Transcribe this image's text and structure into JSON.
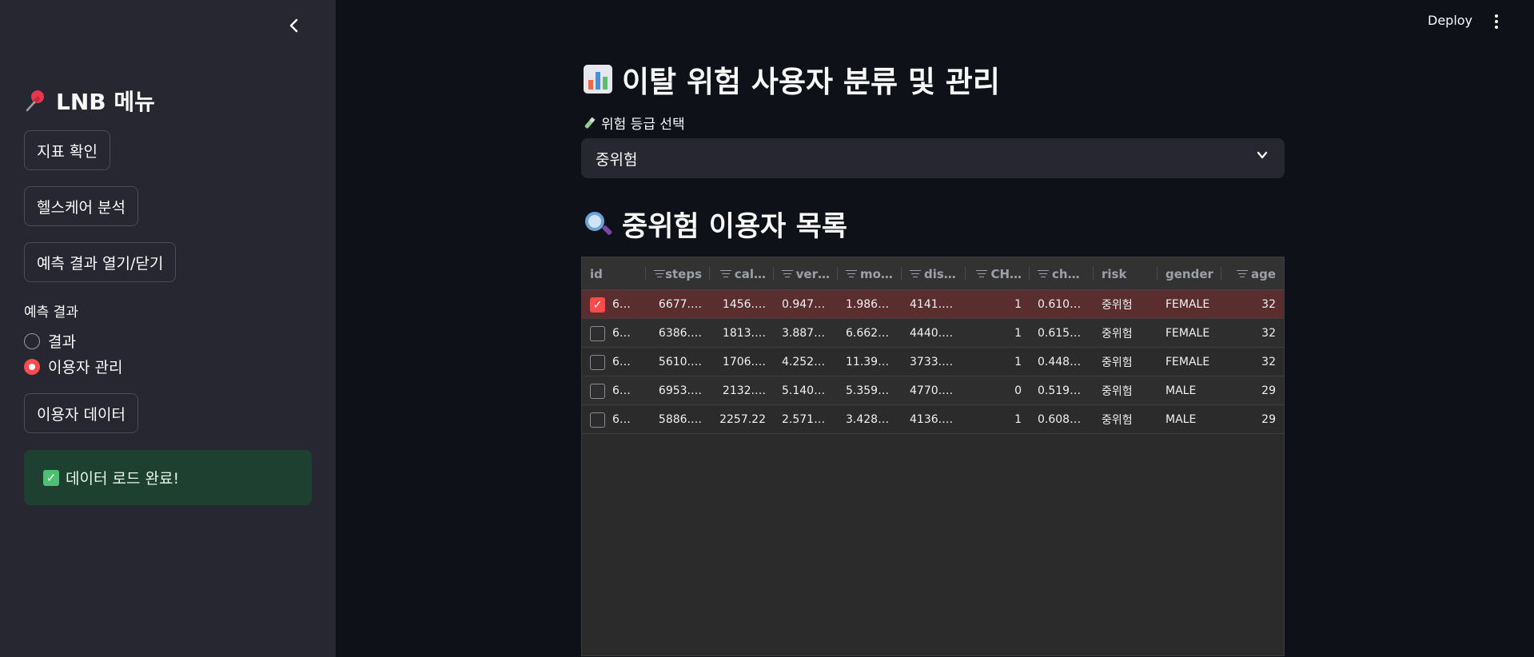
{
  "sidebar": {
    "title": "LNB 메뉴",
    "buttons": [
      "지표 확인",
      "헬스케어 분석",
      "예측 결과 열기/닫기"
    ],
    "radio_caption": "예측 결과",
    "radio_options": [
      {
        "label": "결과",
        "selected": false
      },
      {
        "label": "이용자 관리",
        "selected": true
      }
    ],
    "data_button": "이용자 데이터",
    "success_message": "데이터 로드 완료!"
  },
  "header": {
    "deploy_label": "Deploy"
  },
  "main": {
    "title": "이탈 위험 사용자 분류 및 관리",
    "select_label": "위험 등급 선택",
    "select_value": "중위험",
    "section_title": "중위험 이용자 목록"
  },
  "table": {
    "columns": [
      "id",
      "steps",
      "cal…",
      "ver…",
      "mo…",
      "dis…",
      "CH…",
      "ch…",
      "risk",
      "gender",
      "age"
    ],
    "rows": [
      {
        "selected": true,
        "cells": [
          "6…",
          "6677.…",
          "1456.…",
          "0.947…",
          "1.986…",
          "4141.…",
          "1",
          "0.610…",
          "중위험",
          "FEMALE",
          "32"
        ]
      },
      {
        "selected": false,
        "cells": [
          "6…",
          "6386.…",
          "1813.…",
          "3.887…",
          "6.662…",
          "4440.…",
          "1",
          "0.615…",
          "중위험",
          "FEMALE",
          "32"
        ]
      },
      {
        "selected": false,
        "cells": [
          "6…",
          "5610.…",
          "1706.…",
          "4.252…",
          "11.39…",
          "3733.…",
          "1",
          "0.448…",
          "중위험",
          "FEMALE",
          "32"
        ]
      },
      {
        "selected": false,
        "cells": [
          "6…",
          "6953.…",
          "2132.…",
          "5.140…",
          "5.359…",
          "4770.…",
          "0",
          "0.519…",
          "중위험",
          "MALE",
          "29"
        ]
      },
      {
        "selected": false,
        "cells": [
          "6…",
          "5886.…",
          "2257.22",
          "2.571…",
          "3.428…",
          "4136.…",
          "1",
          "0.608…",
          "중위험",
          "MALE",
          "29"
        ]
      }
    ]
  },
  "colors": {
    "accent": "#ff4b4b",
    "success_bg": "#1e4030",
    "sidebar_bg": "#262730",
    "main_bg": "#0e1117"
  },
  "icons": {
    "title_icon": "bar-chart-icon",
    "select_icon": "test-tube-icon",
    "section_icon": "magnifier-icon",
    "sidebar_title_icon": "pushpin-icon"
  }
}
